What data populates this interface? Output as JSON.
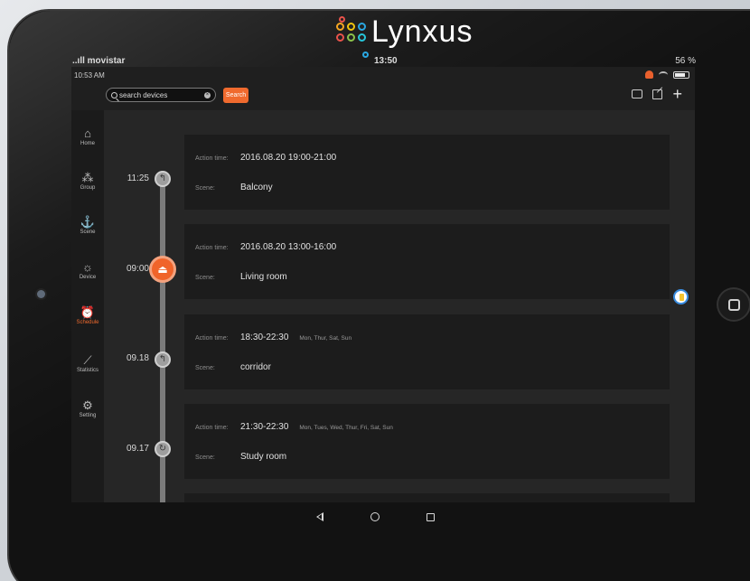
{
  "brand": {
    "name": "Lynxus"
  },
  "outer_status": {
    "carrier": "..ıll movistar",
    "time": "13:50",
    "battery": "56 %"
  },
  "inner_status": {
    "time": "10:53 AM"
  },
  "search": {
    "placeholder": "search devices",
    "button_label": "Search"
  },
  "sidebar": {
    "items": [
      {
        "label": "Home",
        "icon": "home-icon"
      },
      {
        "label": "Group",
        "icon": "group-icon"
      },
      {
        "label": "Scene",
        "icon": "scene-icon"
      },
      {
        "label": "Device",
        "icon": "device-icon"
      },
      {
        "label": "Schedule",
        "icon": "schedule-icon",
        "active": true
      },
      {
        "label": "Statistics",
        "icon": "statistics-icon"
      },
      {
        "label": "Setting",
        "icon": "setting-icon"
      }
    ]
  },
  "schedule": {
    "entries": [
      {
        "time": "11:25",
        "action_label": "Action time:",
        "action_time": "2016.08.20 19:00-21:00",
        "days": "",
        "scene_label": "Scene:",
        "scene": "Balcony"
      },
      {
        "time": "09:00",
        "action_label": "Action time:",
        "action_time": "2016.08.20 13:00-16:00",
        "days": "",
        "scene_label": "Scene:",
        "scene": "Living room",
        "active": true
      },
      {
        "time": "09.18",
        "action_label": "Action time:",
        "action_time": "18:30-22:30",
        "days": "Mon, Thur, Sat, Sun",
        "scene_label": "Scene:",
        "scene": "corridor"
      },
      {
        "time": "09.17",
        "action_label": "Action time:",
        "action_time": "21:30-22:30",
        "days": "Mon, Tues, Wed, Thur, Fri, Sat, Sun",
        "scene_label": "Scene:",
        "scene": "Study room"
      }
    ]
  },
  "colors": {
    "accent": "#f06a2e",
    "background": "#262626",
    "card": "#1c1c1c"
  }
}
